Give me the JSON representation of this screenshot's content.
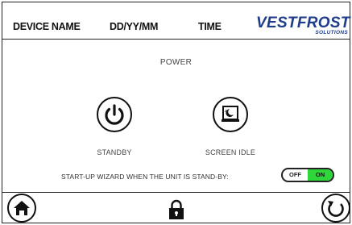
{
  "header": {
    "device_name": "DEVICE NAME",
    "date_format": "DD/YY/MM",
    "time": "TIME",
    "brand": "VESTFROST",
    "brand_sub": "SOLUTIONS"
  },
  "main": {
    "title": "POWER",
    "standby_label": "STANDBY",
    "screen_idle_label": "SCREEN IDLE",
    "wizard_label": "START-UP WIZARD WHEN THE UNIT IS STAND-BY:",
    "toggle": {
      "off_label": "OFF",
      "on_label": "ON",
      "state": "on"
    }
  },
  "footer": {
    "home_icon": "home-icon",
    "lock_icon": "lock-icon",
    "back_icon": "back-icon"
  },
  "colors": {
    "brand": "#1f3d8a",
    "toggle_on": "#2fd63a"
  }
}
